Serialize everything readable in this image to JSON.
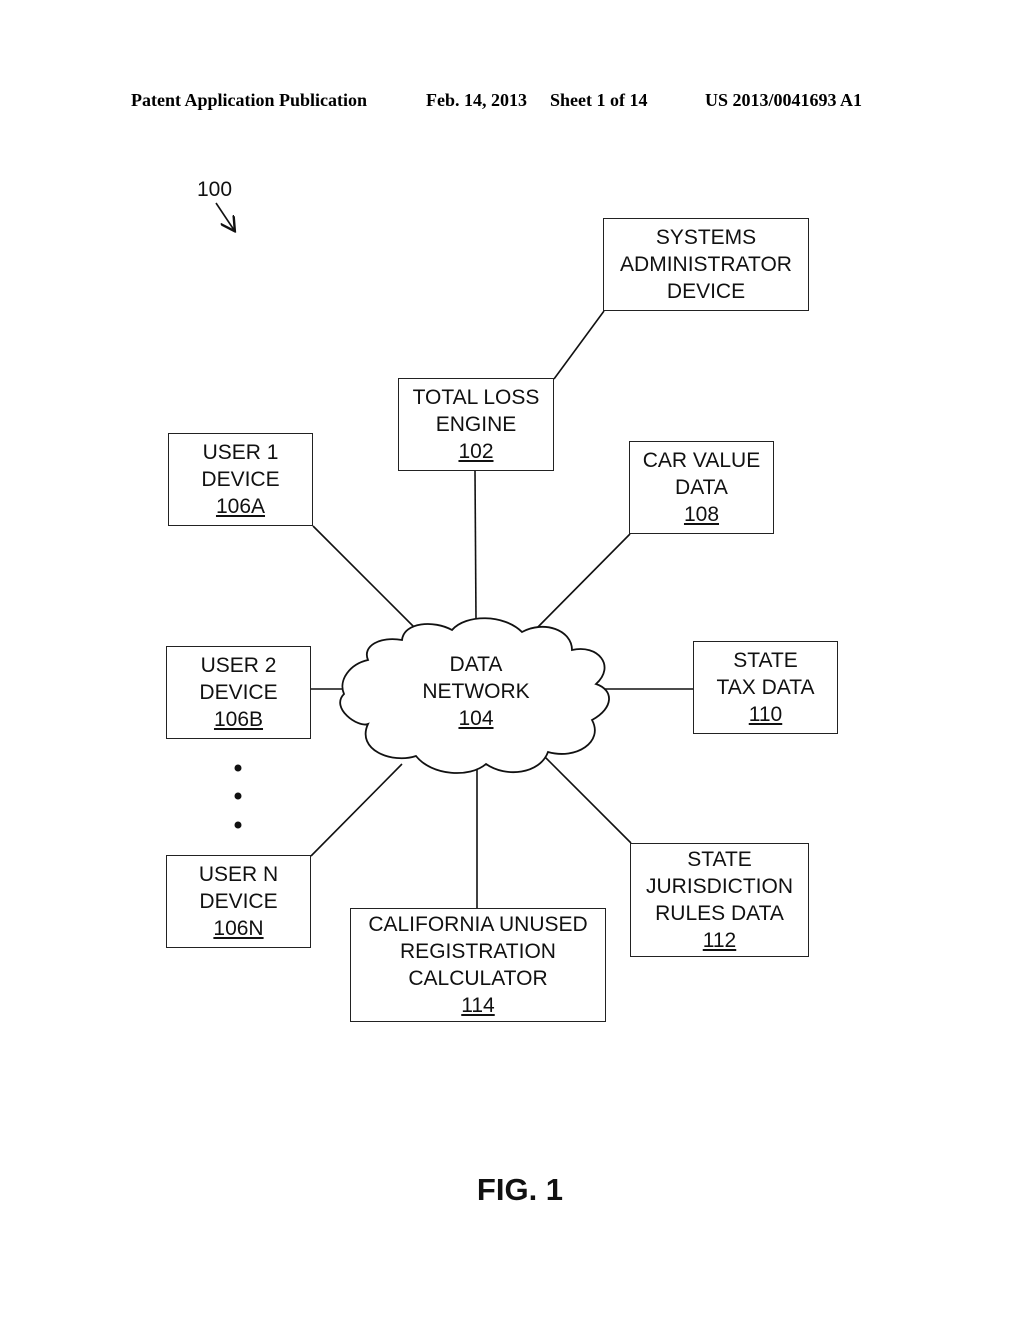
{
  "header": {
    "publication": "Patent Application Publication",
    "date": "Feb. 14, 2013",
    "sheet": "Sheet 1 of 14",
    "number": "US 2013/0041693 A1"
  },
  "figure_ref": "100",
  "figure_caption": "FIG. 1",
  "nodes": {
    "sysadmin": {
      "lines": [
        "SYSTEMS",
        "ADMINISTRATOR",
        "DEVICE"
      ],
      "ref": ""
    },
    "total_loss": {
      "lines": [
        "TOTAL LOSS",
        "ENGINE"
      ],
      "ref": "102"
    },
    "user1": {
      "lines": [
        "USER 1",
        "DEVICE"
      ],
      "ref": "106A"
    },
    "car_value": {
      "lines": [
        "CAR VALUE",
        "DATA"
      ],
      "ref": "108"
    },
    "user2": {
      "lines": [
        "USER 2",
        "DEVICE"
      ],
      "ref": "106B"
    },
    "network": {
      "lines": [
        "DATA",
        "NETWORK"
      ],
      "ref": "104"
    },
    "state_tax": {
      "lines": [
        "STATE",
        "TAX DATA"
      ],
      "ref": "110"
    },
    "usern": {
      "lines": [
        "USER N",
        "DEVICE"
      ],
      "ref": "106N"
    },
    "state_rules": {
      "lines": [
        "STATE",
        "JURISDICTION",
        "RULES DATA"
      ],
      "ref": "112"
    },
    "ca_calc": {
      "lines": [
        "CALIFORNIA UNUSED",
        "REGISTRATION",
        "CALCULATOR"
      ],
      "ref": "114"
    }
  }
}
